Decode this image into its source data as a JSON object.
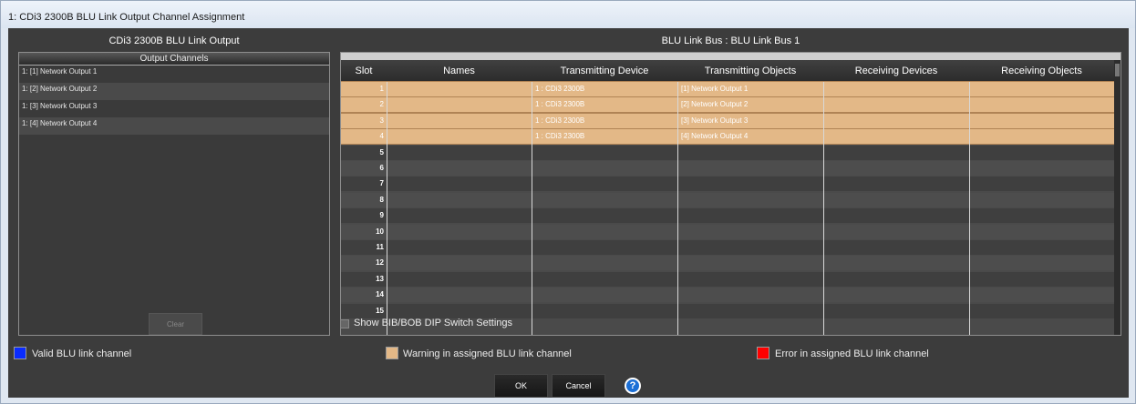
{
  "window": {
    "title": "1: CDi3 2300B BLU Link Output Channel Assignment"
  },
  "left": {
    "header": "CDi3 2300B  BLU Link Output",
    "list_header": "Output Channels",
    "items": [
      "1: [1] Network Output 1",
      "1: [2] Network Output 2",
      "1: [3] Network Output 3",
      "1: [4] Network Output 4"
    ],
    "clear_label": "Clear"
  },
  "right": {
    "header": "BLU Link Bus : BLU Link Bus 1",
    "columns": [
      "Slot",
      "Names",
      "Transmitting Device",
      "Transmitting Objects",
      "Receiving Devices",
      "Receiving Objects"
    ],
    "rows": [
      {
        "slot": "1",
        "names": "",
        "tx_device": "1 : CDi3 2300B",
        "tx_objects": "[1] Network Output 1",
        "rx_devices": "",
        "rx_objects": "",
        "assigned": true
      },
      {
        "slot": "2",
        "names": "",
        "tx_device": "1 : CDi3 2300B",
        "tx_objects": "[2] Network Output 2",
        "rx_devices": "",
        "rx_objects": "",
        "assigned": true
      },
      {
        "slot": "3",
        "names": "",
        "tx_device": "1 : CDi3 2300B",
        "tx_objects": "[3] Network Output 3",
        "rx_devices": "",
        "rx_objects": "",
        "assigned": true
      },
      {
        "slot": "4",
        "names": "",
        "tx_device": "1 : CDi3 2300B",
        "tx_objects": "[4] Network Output 4",
        "rx_devices": "",
        "rx_objects": "",
        "assigned": true
      },
      {
        "slot": "5",
        "names": "",
        "tx_device": "",
        "tx_objects": "",
        "rx_devices": "",
        "rx_objects": "",
        "assigned": false
      },
      {
        "slot": "6",
        "names": "",
        "tx_device": "",
        "tx_objects": "",
        "rx_devices": "",
        "rx_objects": "",
        "assigned": false
      },
      {
        "slot": "7",
        "names": "",
        "tx_device": "",
        "tx_objects": "",
        "rx_devices": "",
        "rx_objects": "",
        "assigned": false
      },
      {
        "slot": "8",
        "names": "",
        "tx_device": "",
        "tx_objects": "",
        "rx_devices": "",
        "rx_objects": "",
        "assigned": false
      },
      {
        "slot": "9",
        "names": "",
        "tx_device": "",
        "tx_objects": "",
        "rx_devices": "",
        "rx_objects": "",
        "assigned": false
      },
      {
        "slot": "10",
        "names": "",
        "tx_device": "",
        "tx_objects": "",
        "rx_devices": "",
        "rx_objects": "",
        "assigned": false
      },
      {
        "slot": "11",
        "names": "",
        "tx_device": "",
        "tx_objects": "",
        "rx_devices": "",
        "rx_objects": "",
        "assigned": false
      },
      {
        "slot": "12",
        "names": "",
        "tx_device": "",
        "tx_objects": "",
        "rx_devices": "",
        "rx_objects": "",
        "assigned": false
      },
      {
        "slot": "13",
        "names": "",
        "tx_device": "",
        "tx_objects": "",
        "rx_devices": "",
        "rx_objects": "",
        "assigned": false
      },
      {
        "slot": "14",
        "names": "",
        "tx_device": "",
        "tx_objects": "",
        "rx_devices": "",
        "rx_objects": "",
        "assigned": false
      },
      {
        "slot": "15",
        "names": "",
        "tx_device": "",
        "tx_objects": "",
        "rx_devices": "",
        "rx_objects": "",
        "assigned": false
      }
    ]
  },
  "options": {
    "show_dip_label": "Show BIB/BOB DIP Switch Settings",
    "show_dip_checked": false
  },
  "legend": [
    {
      "label": "Valid BLU link channel",
      "color": "#0a2cff"
    },
    {
      "label": "Warning in assigned BLU link channel",
      "color": "#e3b887"
    },
    {
      "label": "Error in assigned BLU link channel",
      "color": "#ff0000"
    }
  ],
  "buttons": {
    "ok": "OK",
    "cancel": "Cancel",
    "help": "?"
  }
}
